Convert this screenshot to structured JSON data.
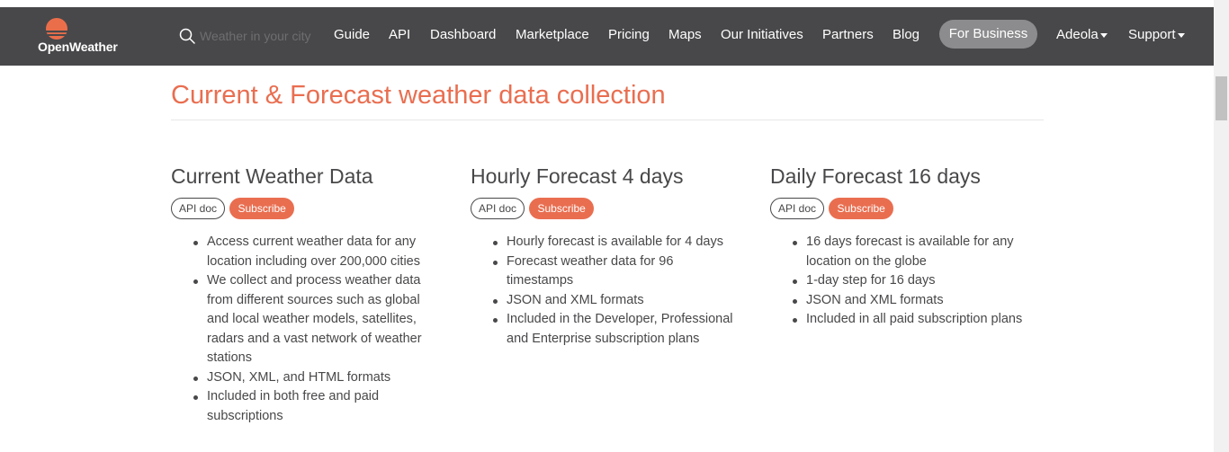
{
  "header": {
    "logo_text": "OpenWeather",
    "search": {
      "placeholder": "Weather in your city",
      "value": ""
    },
    "nav": [
      {
        "label": "Guide"
      },
      {
        "label": "API"
      },
      {
        "label": "Dashboard"
      },
      {
        "label": "Marketplace"
      },
      {
        "label": "Pricing"
      },
      {
        "label": "Maps"
      },
      {
        "label": "Our Initiatives"
      },
      {
        "label": "Partners"
      },
      {
        "label": "Blog"
      }
    ],
    "business_button": "For Business",
    "user_menu": "Adeola",
    "support_menu": "Support"
  },
  "main": {
    "heading": "Current & Forecast weather data collection",
    "products": [
      {
        "title": "Current Weather Data",
        "api_doc": "API doc",
        "subscribe": "Subscribe",
        "features": [
          "Access current weather data for any location including over 200,000 cities",
          "We collect and process weather data from different sources such as global and local weather models, satellites, radars and a vast network of weather stations",
          "JSON, XML, and HTML formats",
          "Included in both free and paid subscriptions"
        ]
      },
      {
        "title": "Hourly Forecast 4 days",
        "api_doc": "API doc",
        "subscribe": "Subscribe",
        "features": [
          "Hourly forecast is available for 4 days",
          "Forecast weather data for 96 timestamps",
          "JSON and XML formats",
          "Included in the Developer, Professional and Enterprise subscription plans"
        ]
      },
      {
        "title": "Daily Forecast 16 days",
        "api_doc": "API doc",
        "subscribe": "Subscribe",
        "features": [
          "16 days forecast is available for any location on the globe",
          "1-day step for 16 days",
          "JSON and XML formats",
          "Included in all paid subscription plans"
        ]
      }
    ]
  },
  "colors": {
    "navbar": "#48484a",
    "accent": "#e96e50",
    "text": "#48484a",
    "business_button": "#8c8c8e"
  },
  "icons": {
    "logo": "openweather-sun-logo-icon",
    "search": "search-icon",
    "dropdown": "caret-down-icon"
  }
}
